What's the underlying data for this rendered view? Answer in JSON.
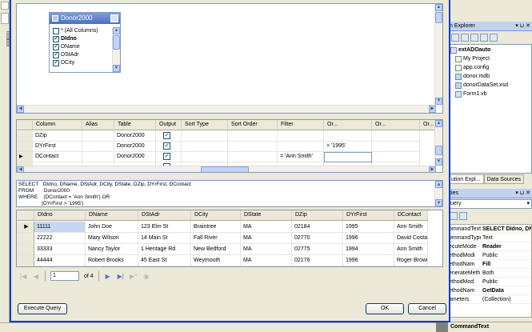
{
  "ide": {
    "left_toolbox_label": "Toolbox",
    "solution_explorer": {
      "title": "n Explorer",
      "controls": "▾ ⊔ ✕",
      "tree": [
        {
          "label": "extADOauto",
          "bold": true,
          "icon": "project"
        },
        {
          "label": "My Project",
          "icon": "folder"
        },
        {
          "label": "app.config",
          "icon": "file"
        },
        {
          "label": "donor.mdb",
          "icon": "db"
        },
        {
          "label": "donorDataSet.xsd",
          "icon": "db"
        },
        {
          "label": "Form1.vb",
          "icon": "vb"
        }
      ],
      "tab_solution": "ution Expl...",
      "tab_datasources": "Data Sources"
    },
    "properties": {
      "title": "ties",
      "controls": "▾ ⊔ ✕",
      "combo_value": "uery",
      "rows": [
        {
          "name": "ommandText",
          "value": "SELECT DIdno, DN",
          "bold": true
        },
        {
          "name": "ommandType",
          "value": "Text",
          "bold": false
        },
        {
          "name": "ecuteMode",
          "value": "Reader",
          "bold": true
        },
        {
          "name": "ethodModi",
          "value": "Public",
          "bold": false
        },
        {
          "name": "ethodNam",
          "value": "Fill",
          "bold": true
        },
        {
          "name": "enerateMeth",
          "value": "Both",
          "bold": false
        },
        {
          "name": "ethodMod",
          "value": "Public",
          "bold": false
        },
        {
          "name": "ethodNam",
          "value": "GetData",
          "bold": true
        },
        {
          "name": "ameters",
          "value": "(Collection)",
          "bold": false
        }
      ],
      "description_title": "CommandText"
    }
  },
  "dialog": {
    "table_box": {
      "title": "Donor2000",
      "columns": [
        {
          "label": "* (All Columns)",
          "checked": false,
          "bold": false
        },
        {
          "label": "DIdno",
          "checked": true,
          "bold": true
        },
        {
          "label": "DName",
          "checked": true,
          "bold": false
        },
        {
          "label": "DStAdr",
          "checked": true,
          "bold": false
        },
        {
          "label": "DCity",
          "checked": true,
          "bold": false
        }
      ]
    },
    "criteria_grid": {
      "headers": [
        "",
        "Column",
        "Alias",
        "Table",
        "Output",
        "Sort Type",
        "Sort Order",
        "Filter",
        "Or...",
        "Or...",
        "Or..."
      ],
      "rows": [
        {
          "marker": "",
          "column": "DZip",
          "alias": "",
          "table": "Donor2000",
          "output": true,
          "sort_type": "",
          "sort_order": "",
          "filter": "",
          "or1": "",
          "or2": ""
        },
        {
          "marker": "",
          "column": "DYrFirst",
          "alias": "",
          "table": "Donor2000",
          "output": true,
          "sort_type": "",
          "sort_order": "",
          "filter": "",
          "or1": "> '1995'",
          "or2": ""
        },
        {
          "marker": "▶",
          "column": "DContact",
          "alias": "",
          "table": "Donor2000",
          "output": true,
          "sort_type": "",
          "sort_order": "",
          "filter": "= 'Ann Smith'",
          "or1": "",
          "or2": ""
        }
      ]
    },
    "sql_lines": [
      "SELECT   DIdno, DName, DStAdr, DCity, DState, DZip, DYrFirst, DContact",
      "FROM       Donor2000",
      "WHERE    (DContact = 'Ann Smith') OR",
      "                (DYrFirst > '1995')"
    ],
    "results": {
      "headers": [
        "",
        "DIdno",
        "DName",
        "DStAdr",
        "DCity",
        "DState",
        "DZip",
        "DYrFirst",
        "DContact"
      ],
      "rows": [
        {
          "marker": "▶",
          "cells": [
            "11111",
            "John Doe",
            "123 Elm St",
            "Braintree",
            "MA",
            "02184",
            "1995",
            "Ann Smith"
          ]
        },
        {
          "marker": "",
          "cells": [
            "22222",
            "Mary Wilson",
            "14 Main St",
            "Fall River",
            "MA",
            "02770",
            "1996",
            "David Costa"
          ]
        },
        {
          "marker": "",
          "cells": [
            "33333",
            "Nancy Taylor",
            "1 Heritage Rd",
            "New Bedford",
            "MA",
            "02775",
            "1994",
            "Ann Smith"
          ]
        },
        {
          "marker": "",
          "cells": [
            "44444",
            "Robert Brooks",
            "45 East St",
            "Weymouth",
            "MA",
            "02176",
            "1996",
            "Roger Brown"
          ]
        }
      ]
    },
    "navigator": {
      "position": "1",
      "total": "of 4"
    },
    "buttons": {
      "execute": "Execute Query",
      "ok": "OK",
      "cancel": "Cancel"
    }
  }
}
